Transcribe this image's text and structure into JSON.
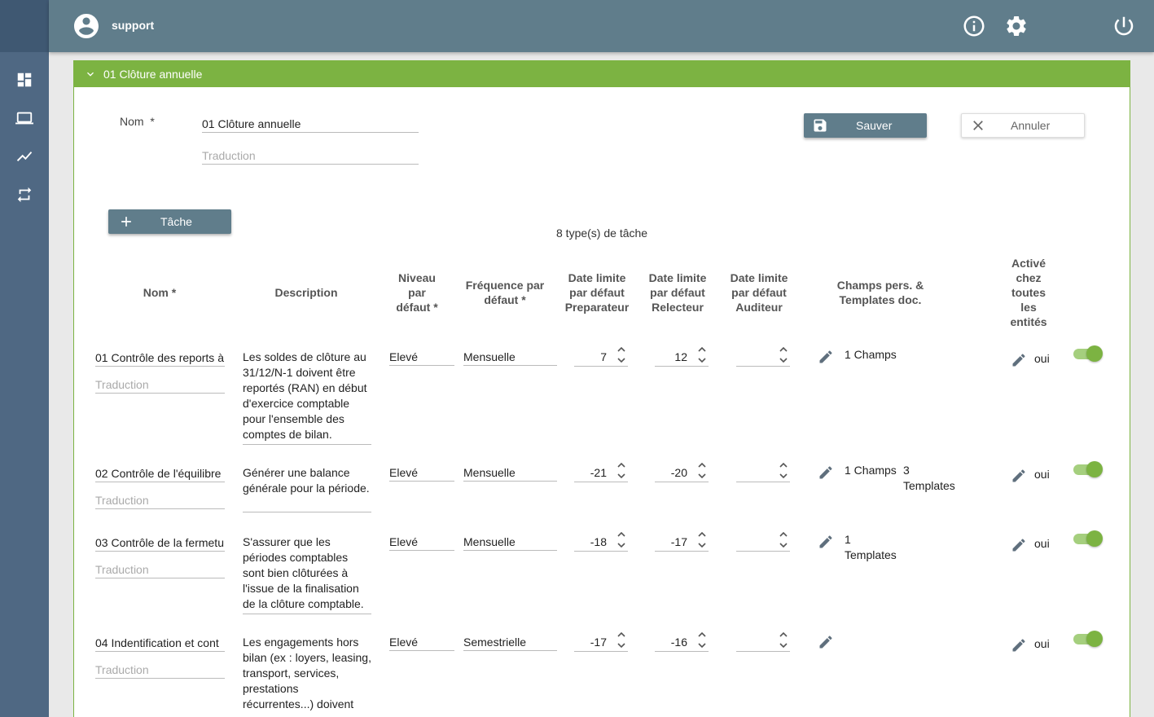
{
  "user": {
    "name": "support",
    "icon": "account-circle-icon"
  },
  "topbar_icons": [
    "info-icon",
    "gear-icon",
    "power-icon"
  ],
  "sidebar": {
    "items": [
      "dashboard-icon",
      "laptop-icon",
      "chart-line-icon",
      "sync-icon"
    ]
  },
  "panel": {
    "title": "01 Clôture annuelle"
  },
  "form": {
    "name_label": "Nom",
    "required_mark": "*",
    "name_value": "01 Clôture annuelle",
    "translation_placeholder": "Traduction",
    "save_label": "Sauver",
    "cancel_label": "Annuler"
  },
  "tasks": {
    "add_label": "Tâche",
    "count_text": "8 type(s) de tâche",
    "headers": {
      "nom": "Nom *",
      "description": "Description",
      "niveau": "Niveau par défaut *",
      "frequence": "Fréquence par défaut *",
      "date_prep": "Date limite par défaut Preparateur",
      "date_relect": "Date limite par défaut Relecteur",
      "date_audit": "Date limite par défaut Auditeur",
      "champs": "Champs pers. & Templates doc.",
      "active": "Activé chez toutes les entités"
    },
    "rows": [
      {
        "name": "01 Contrôle des reports à",
        "translation": "Traduction",
        "description": "Les soldes de clôture au 31/12/N-1 doivent être reportés (RAN) en début d'exercice comptable pour l'ensemble des comptes de bilan.",
        "niveau": "Elevé",
        "frequence": "Mensuelle",
        "prep": "7",
        "relect": "12",
        "audit": "",
        "champs": "1 Champs",
        "templates": "",
        "active": "oui"
      },
      {
        "name": "02 Contrôle de l'équilibre",
        "translation": "Traduction",
        "description": "Générer une balance générale pour la période.",
        "niveau": "Elevé",
        "frequence": "Mensuelle",
        "prep": "-21",
        "relect": "-20",
        "audit": "",
        "champs": "1 Champs",
        "templates": "3 Templates",
        "active": "oui"
      },
      {
        "name": "03 Contrôle de la fermetu",
        "translation": "Traduction",
        "description": "S'assurer que les périodes comptables sont bien clôturées à l'issue de la finalisation de la clôture comptable.",
        "niveau": "Elevé",
        "frequence": "Mensuelle",
        "prep": "-18",
        "relect": "-17",
        "audit": "",
        "champs": "",
        "templates": "1 Templates",
        "active": "oui"
      },
      {
        "name": "04 Indentification et cont",
        "translation": "Traduction",
        "description": "Les engagements hors bilan (ex : loyers, leasing, transport, services, prestations récurrentes...) doivent être recensés et",
        "niveau": "Elevé",
        "frequence": "Semestrielle",
        "prep": "-17",
        "relect": "-16",
        "audit": "",
        "champs": "",
        "templates": "",
        "active": "oui"
      }
    ]
  },
  "colors": {
    "sidebar": "#4f6883",
    "topbar": "#607d8b",
    "accent": "#7cb342"
  }
}
